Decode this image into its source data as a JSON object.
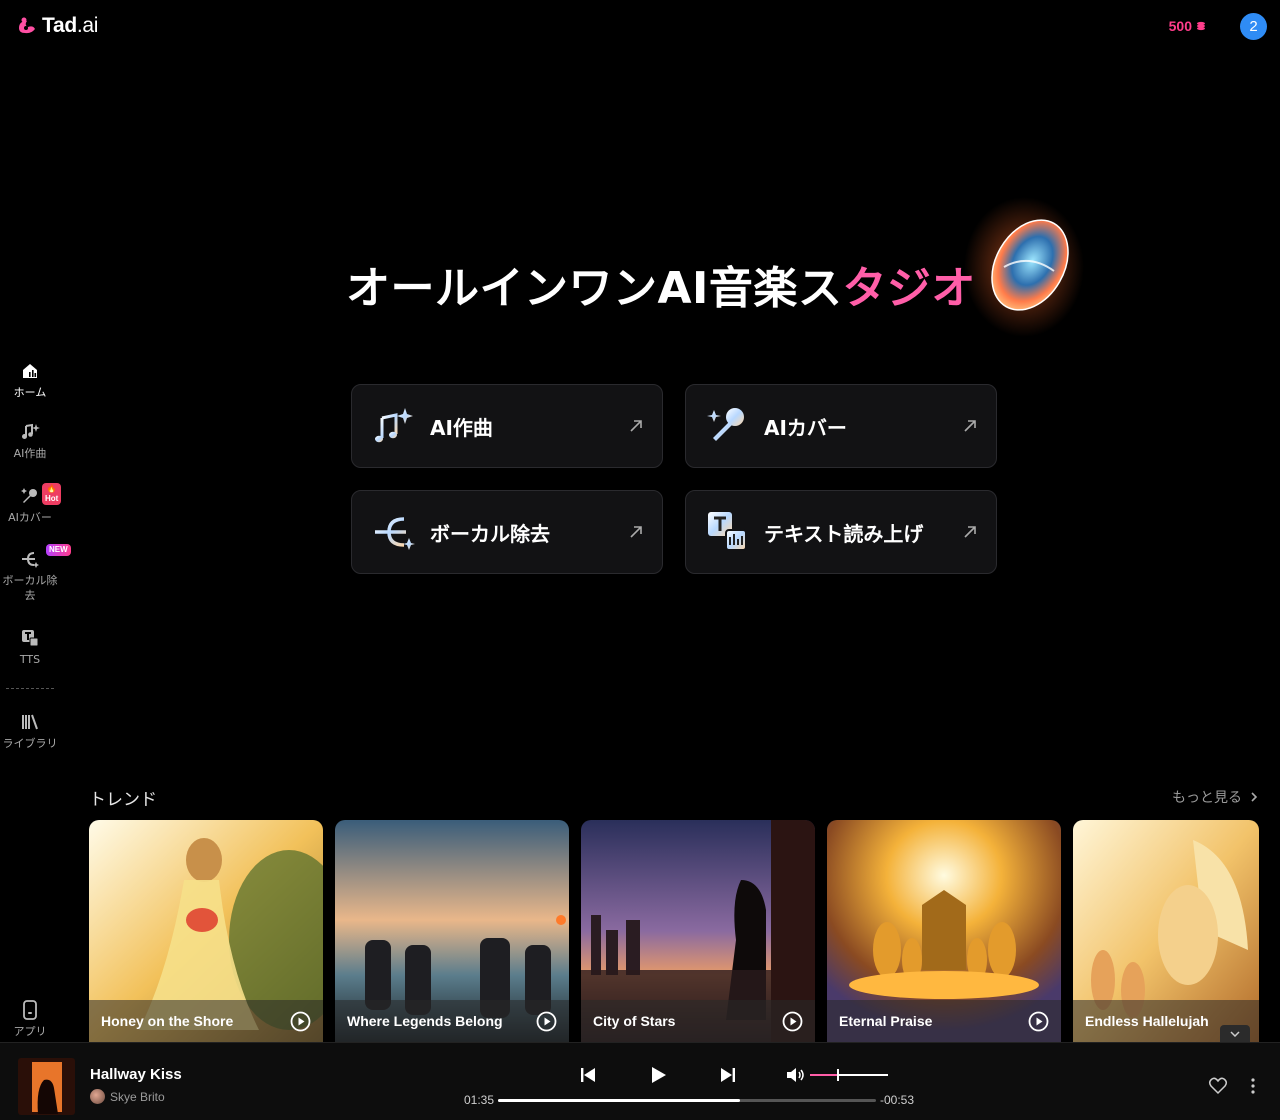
{
  "header": {
    "logo_text": "Tad",
    "logo_suffix": ".ai",
    "credits": "500",
    "notifications": "2"
  },
  "sidebar": {
    "items": [
      {
        "label": "ホーム",
        "icon": "home-icon",
        "active": true
      },
      {
        "label": "AI作曲",
        "icon": "music-sparkle-icon"
      },
      {
        "label": "AIカバー",
        "icon": "microphone-sparkle-icon",
        "badge": "🔥Hot"
      },
      {
        "label": "ボーカル除去",
        "icon": "split-icon",
        "badge": "NEW"
      },
      {
        "label": "TTS",
        "icon": "text-speech-icon"
      },
      {
        "label": "ライブラリ",
        "icon": "library-icon"
      }
    ],
    "app_label": "アプリ"
  },
  "hero": {
    "title_main": "オールインワンAI音楽ス",
    "title_accent": "タジオ"
  },
  "features": [
    {
      "label": "AI作曲",
      "icon": "music-notes-icon"
    },
    {
      "label": "AIカバー",
      "icon": "microphone-icon"
    },
    {
      "label": "ボーカル除去",
      "icon": "vocal-split-icon"
    },
    {
      "label": "テキスト読み上げ",
      "icon": "text-to-speech-icon"
    }
  ],
  "trend": {
    "title": "トレンド",
    "see_more": "もっと見る",
    "tracks": [
      {
        "title": "Honey on the Shore"
      },
      {
        "title": "Where Legends Belong"
      },
      {
        "title": "City of Stars"
      },
      {
        "title": "Eternal Praise"
      },
      {
        "title": "Endless Hallelujah"
      }
    ]
  },
  "player": {
    "title": "Hallway Kiss",
    "artist": "Skye Brito",
    "elapsed": "01:35",
    "remaining": "-00:53",
    "progress": 0.64,
    "volume": 0.35
  },
  "colors": {
    "accent": "#ff5ea8",
    "credits": "#ff3d8b",
    "badge_blue": "#2f8cf5"
  }
}
